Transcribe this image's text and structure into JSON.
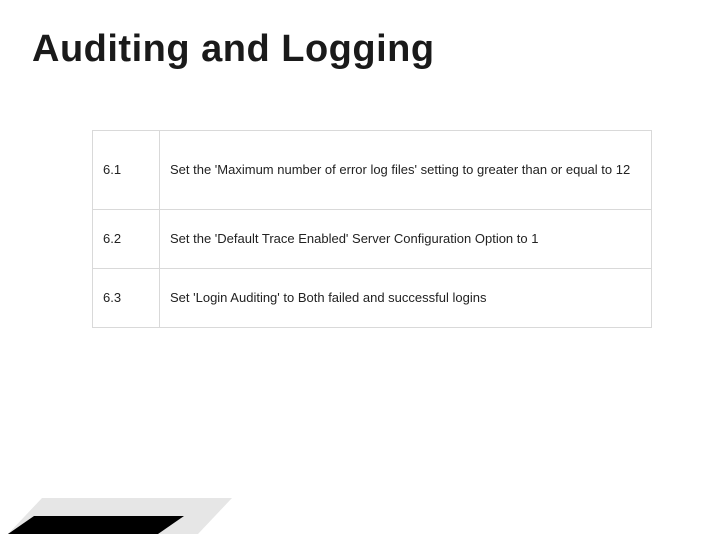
{
  "title": "Auditing and Logging",
  "rows": [
    {
      "num": "6.1",
      "text": "Set the 'Maximum number of error log files' setting to greater than or equal to 12"
    },
    {
      "num": "6.2",
      "text": "Set the 'Default Trace Enabled' Server Configuration Option to 1"
    },
    {
      "num": "6.3",
      "text": "Set 'Login Auditing' to Both failed and successful logins"
    }
  ]
}
